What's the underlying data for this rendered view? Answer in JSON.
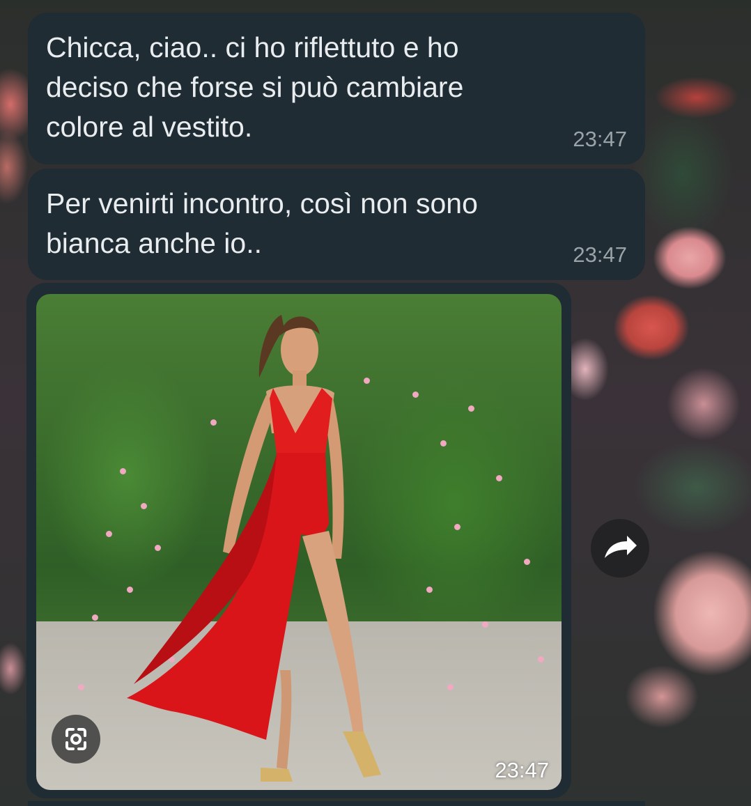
{
  "chat": {
    "messages": [
      {
        "type": "text",
        "text": "Chicca, ciao.. ci ho riflettuto e ho\ndeciso che forse si può cambiare\ncolore al vestito.",
        "time": "23:47"
      },
      {
        "type": "text",
        "text": "Per venirti incontro, così non sono\nbianca anche io..",
        "time": "23:47"
      },
      {
        "type": "image",
        "image_description_icon": "photo",
        "time": "23:47"
      }
    ]
  },
  "icons": {
    "scan": "scan-icon",
    "forward": "forward-icon"
  },
  "colors": {
    "bubble_bg": "#1f2c34",
    "bubble_text": "#e9edef",
    "timestamp": "#9aa3a8",
    "dress_red": "#e21d1d"
  }
}
